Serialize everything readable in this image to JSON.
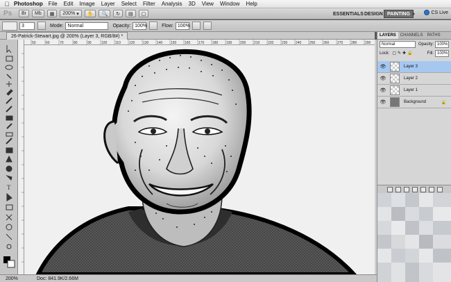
{
  "menubar": {
    "app_name": "Photoshop",
    "items": [
      "File",
      "Edit",
      "Image",
      "Layer",
      "Select",
      "Filter",
      "Analysis",
      "3D",
      "View",
      "Window",
      "Help"
    ]
  },
  "appbar": {
    "logo": "Ps",
    "zoom": "200%",
    "workspaces": [
      "ESSENTIALS",
      "DESIGN",
      "PAINTING"
    ],
    "active_workspace": "PAINTING",
    "more": "»",
    "cs_live": "CS Live"
  },
  "options": {
    "brush_size": "3",
    "mode_label": "Mode:",
    "mode_value": "Normal",
    "opacity_label": "Opacity:",
    "opacity_value": "100%",
    "flow_label": "Flow:",
    "flow_value": "100%"
  },
  "document": {
    "tab_title": "26-Patrick-Stewart.jpg @ 200% (Layer 3, RGB/8#) *"
  },
  "ruler": {
    "ticks": [
      "50",
      "60",
      "70",
      "80",
      "90",
      "100",
      "110",
      "120",
      "130",
      "140",
      "150",
      "160",
      "170",
      "180",
      "190",
      "200",
      "210",
      "220",
      "230",
      "240",
      "250",
      "260",
      "270",
      "280",
      "290",
      "300"
    ]
  },
  "status": {
    "zoom": "200%",
    "doc": "Doc: 841.9K/2.66M"
  },
  "layers_panel": {
    "tabs": [
      "LAYERS",
      "CHANNELS",
      "PATHS"
    ],
    "active_tab": "LAYERS",
    "blend_mode": "Normal",
    "opacity_label": "Opacity:",
    "opacity_value": "100%",
    "lock_label": "Lock:",
    "fill_label": "Fill:",
    "fill_value": "100%",
    "layers": [
      {
        "name": "Layer 3",
        "active": true
      },
      {
        "name": "Layer 2",
        "active": false
      },
      {
        "name": "Layer 1",
        "active": false
      },
      {
        "name": "Background",
        "active": false
      }
    ]
  },
  "colors": {
    "accent": "#2a75c8",
    "selected_layer": "#a6c8f0"
  }
}
